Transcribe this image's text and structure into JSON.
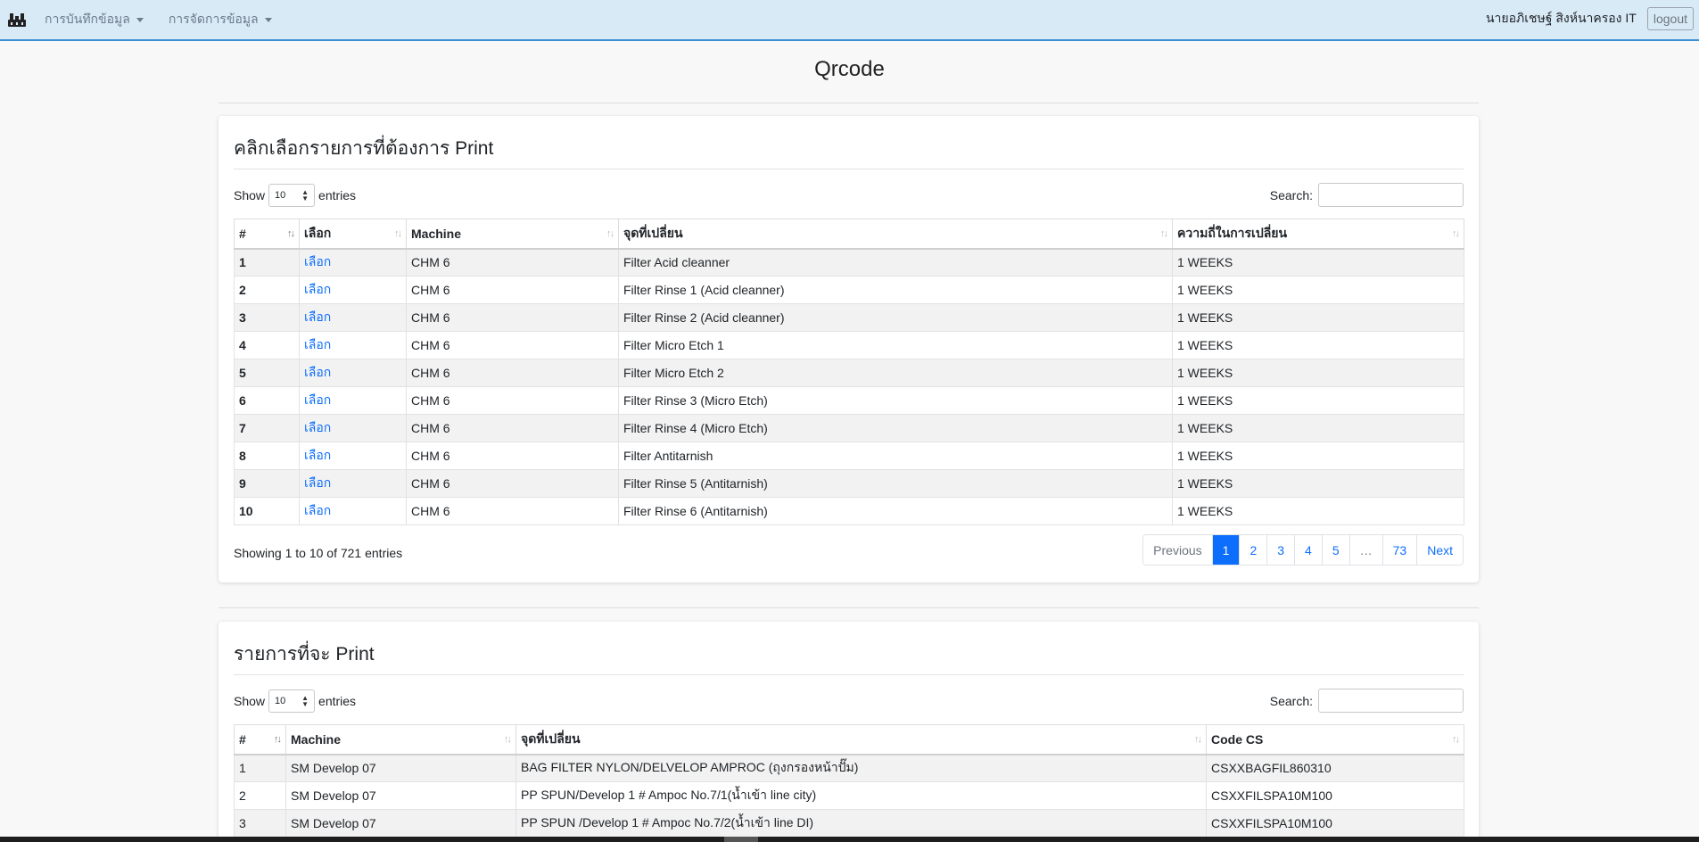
{
  "nav": {
    "items": [
      {
        "label": "การบันทึกข้อมูล"
      },
      {
        "label": "การจัดการข้อมูล"
      }
    ],
    "user": "นายอภิเชษฐ์ สิงห์นาครอง IT",
    "logout": "logout"
  },
  "page": {
    "title": "Qrcode"
  },
  "select_card": {
    "title": "คลิกเลือกรายการที่ต้องการ Print",
    "show_label": "Show",
    "entries_value": "10",
    "entries_label": "entries",
    "search_label": "Search:",
    "columns": [
      "#",
      "เลือก",
      "Machine",
      "จุดที่เปลี่ยน",
      "ความถี่ในการเปลี่ยน"
    ],
    "rows": [
      {
        "no": "1",
        "pick": "เลือก",
        "machine": "CHM 6",
        "point": "Filter Acid cleanner",
        "freq": "1 WEEKS"
      },
      {
        "no": "2",
        "pick": "เลือก",
        "machine": "CHM 6",
        "point": "Filter Rinse 1 (Acid cleanner)",
        "freq": "1 WEEKS"
      },
      {
        "no": "3",
        "pick": "เลือก",
        "machine": "CHM 6",
        "point": "Filter Rinse 2 (Acid cleanner)",
        "freq": "1 WEEKS"
      },
      {
        "no": "4",
        "pick": "เลือก",
        "machine": "CHM 6",
        "point": "Filter Micro Etch 1",
        "freq": "1 WEEKS"
      },
      {
        "no": "5",
        "pick": "เลือก",
        "machine": "CHM 6",
        "point": "Filter Micro Etch 2",
        "freq": "1 WEEKS"
      },
      {
        "no": "6",
        "pick": "เลือก",
        "machine": "CHM 6",
        "point": "Filter Rinse 3 (Micro Etch)",
        "freq": "1 WEEKS"
      },
      {
        "no": "7",
        "pick": "เลือก",
        "machine": "CHM 6",
        "point": "Filter Rinse 4 (Micro Etch)",
        "freq": "1 WEEKS"
      },
      {
        "no": "8",
        "pick": "เลือก",
        "machine": "CHM 6",
        "point": "Filter Antitarnish",
        "freq": "1 WEEKS"
      },
      {
        "no": "9",
        "pick": "เลือก",
        "machine": "CHM 6",
        "point": "Filter Rinse 5 (Antitarnish)",
        "freq": "1 WEEKS"
      },
      {
        "no": "10",
        "pick": "เลือก",
        "machine": "CHM 6",
        "point": "Filter Rinse 6 (Antitarnish)",
        "freq": "1 WEEKS"
      }
    ],
    "info": "Showing 1 to 10 of 721 entries",
    "pagination": [
      "Previous",
      "1",
      "2",
      "3",
      "4",
      "5",
      "…",
      "73",
      "Next"
    ],
    "active_page": "1"
  },
  "print_card": {
    "title": "รายการที่จะ Print",
    "show_label": "Show",
    "entries_value": "10",
    "entries_label": "entries",
    "search_label": "Search:",
    "columns": [
      "#",
      "Machine",
      "จุดที่เปลี่ยน",
      "Code CS"
    ],
    "rows": [
      {
        "no": "1",
        "machine": "SM Develop 07",
        "point": "BAG FILTER NYLON/DELVELOP AMPROC (ถุงกรองหน้าปั๊ม)",
        "code": "CSXXBAGFIL860310"
      },
      {
        "no": "2",
        "machine": "SM Develop 07",
        "point": "PP SPUN/Develop 1 # Ampoc No.7/1(น้ำเข้า line city)",
        "code": "CSXXFILSPA10M100"
      },
      {
        "no": "3",
        "machine": "SM Develop 07",
        "point": "PP SPUN /Develop 1 # Ampoc No.7/2(น้ำเข้า line DI)",
        "code": "CSXXFILSPA10M100"
      }
    ]
  }
}
